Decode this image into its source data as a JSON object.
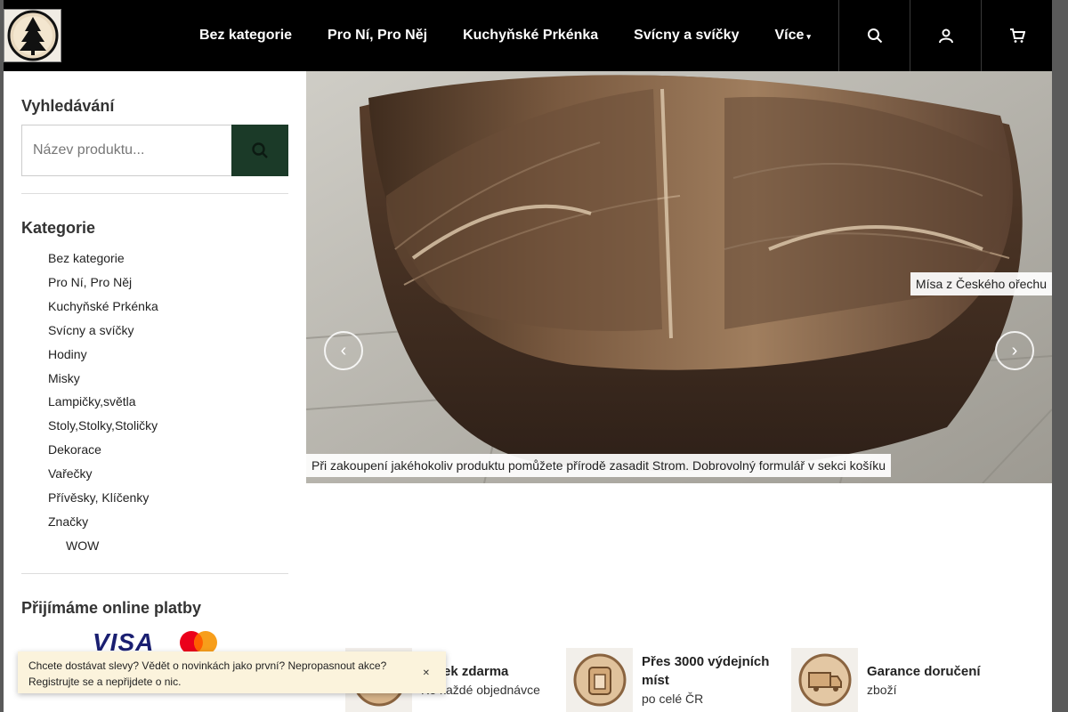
{
  "header": {
    "logo_alt": "logo",
    "nav": [
      {
        "label": "Bez kategorie"
      },
      {
        "label": "Pro Ní, Pro Něj"
      },
      {
        "label": "Kuchyňské Prkénka"
      },
      {
        "label": "Svícny a svíčky"
      },
      {
        "label": "Více"
      }
    ],
    "icons": [
      "search-icon",
      "user-icon",
      "cart-icon"
    ]
  },
  "sidebar": {
    "search_title": "Vyhledávání",
    "search_placeholder": "Název produktu...",
    "categories_title": "Kategorie",
    "categories": [
      {
        "label": "Bez kategorie"
      },
      {
        "label": "Pro Ní, Pro Něj"
      },
      {
        "label": "Kuchyňské Prkénka"
      },
      {
        "label": "Svícny a svíčky"
      },
      {
        "label": "Hodiny"
      },
      {
        "label": "Misky"
      },
      {
        "label": "Lampičky,světla"
      },
      {
        "label": "Stoly,Stolky,Stoličky"
      },
      {
        "label": "Dekorace"
      },
      {
        "label": "Vařečky"
      },
      {
        "label": "Přívěsky, Klíčenky"
      },
      {
        "label": "Značky"
      },
      {
        "label": "WOW"
      }
    ],
    "payments_title": "Přijímáme online platby",
    "visa_label": "VISA"
  },
  "hero": {
    "caption_right": "Mísa z Českého ořechu",
    "caption_bottom": "Při zakoupení jakéhokoliv produktu pomůžete přírodě zasadit Strom. Dobrovolný formulář v sekci košíku"
  },
  "features": [
    {
      "title": "Dárek zdarma",
      "subtitle": "Ke každé objednávce"
    },
    {
      "title": "Přes 3000 výdejních míst",
      "subtitle": "po celé ČR"
    },
    {
      "title": "Garance doručení",
      "subtitle": "zboží"
    }
  ],
  "popup": {
    "text": "Chcete dostávat slevy? Vědět o novinkách jako první? Nepropasnout akce? Registrujte se a nepřijdete o nic."
  },
  "colors": {
    "header_bg": "#000000",
    "search_button": "#1b3a28",
    "popup_bg": "#fbf3dc"
  }
}
